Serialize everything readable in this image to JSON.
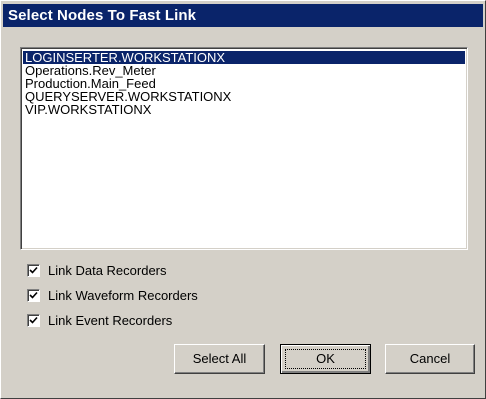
{
  "window": {
    "title": "Select Nodes To Fast Link"
  },
  "nodes": {
    "items": [
      {
        "label": "LOGINSERTER.WORKSTATIONX",
        "selected": true
      },
      {
        "label": "Operations.Rev_Meter",
        "selected": false
      },
      {
        "label": "Production.Main_Feed",
        "selected": false
      },
      {
        "label": "QUERYSERVER.WORKSTATIONX",
        "selected": false
      },
      {
        "label": "VIP.WORKSTATIONX",
        "selected": false
      }
    ]
  },
  "options": [
    {
      "label": "Link Data Recorders",
      "checked": true
    },
    {
      "label": "Link Waveform Recorders",
      "checked": true
    },
    {
      "label": "Link Event Recorders",
      "checked": true
    }
  ],
  "buttons": {
    "select_all": "Select All",
    "ok": "OK",
    "cancel": "Cancel"
  },
  "colors": {
    "titlebar": "#0a246a",
    "face": "#d4d0c8",
    "selection": "#0a246a"
  }
}
